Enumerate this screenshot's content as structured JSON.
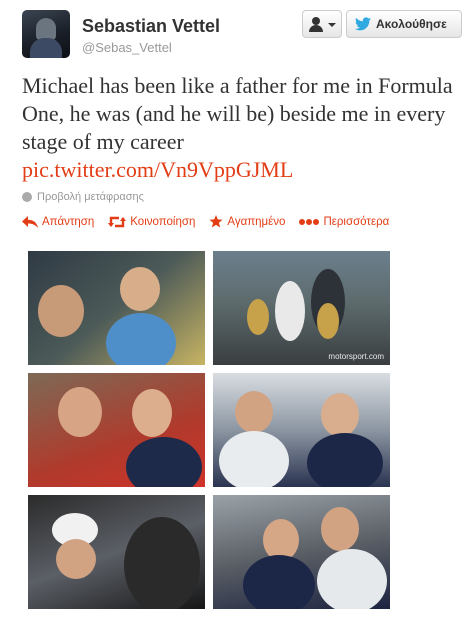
{
  "profile": {
    "name": "Sebastian Vettel",
    "handle": "@Sebas_Vettel"
  },
  "buttons": {
    "follow_label": "Ακολούθησε"
  },
  "tweet": {
    "text": "Michael has been like a father for me in Formula One, he was (and he will be) beside me in every stage of my career",
    "link": "pic.twitter.com/Vn9VppGJML",
    "translate_label": "Προβολή μετάφρασης"
  },
  "actions": {
    "reply": "Απάντηση",
    "retweet": "Κοινοποίηση",
    "favorite": "Αγαπημένο",
    "more": "Περισσότερα"
  },
  "photos": {
    "p2_caption": "motorsport.com"
  },
  "colors": {
    "accent": "#e23d15",
    "text": "#333333",
    "muted": "#999999"
  },
  "icons": [
    "user-icon",
    "twitter-bird-icon",
    "globe-icon",
    "reply-icon",
    "retweet-icon",
    "star-icon",
    "more-dots-icon"
  ]
}
